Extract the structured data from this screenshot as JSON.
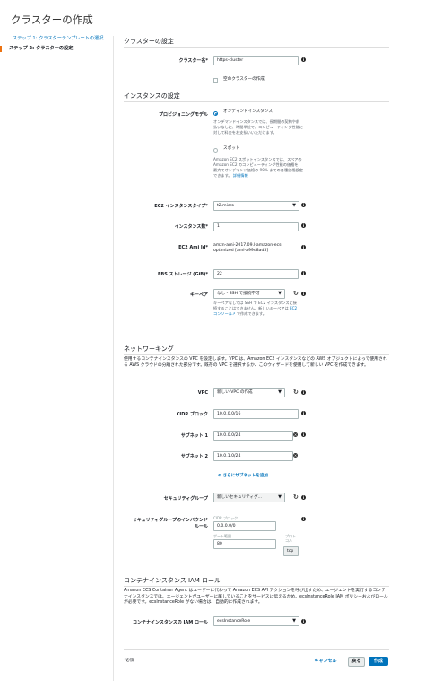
{
  "page": {
    "title": "クラスターの作成"
  },
  "steps": {
    "step1": "ステップ 1: クラスターテンプレートの選択",
    "step2": "ステップ 2: クラスターの設定"
  },
  "cluster": {
    "section_title": "クラスターの設定",
    "name_label": "クラスター名*",
    "name_value": "https-cluster",
    "empty_cluster_label": "空のクラスターの作成"
  },
  "instance": {
    "section_title": "インスタンスの設定",
    "provisioning_label": "プロビジョニングモデル",
    "ondemand_label": "オンデマンドインスタンス",
    "ondemand_desc": "オンデマンドインスタンスでは、長期間の契約や前払いなしに、時間単位で、コンピューティング性能に対して料金をお支払いいただけます。",
    "spot_label": "スポット",
    "spot_desc": "Amazon EC2 スポットインスタンスでは、スペアの Amazon EC2 のコンピューティング性能の価格を、最大でオンデマンド価格の 90% までの各種価格設定できます。",
    "spot_link": "詳細情報",
    "type_label": "EC2 インスタンスタイプ*",
    "type_value": "t2.micro",
    "count_label": "インスタンス数*",
    "count_value": "1",
    "ami_label": "EC2 Ami Id*",
    "ami_value": "amzn-ami-2017.09.l-amazon-ecs-optimized [ami-a99d8ad5]",
    "ebs_label": "EBS ストレージ (GiB)*",
    "ebs_value": "22",
    "keypair_label": "キーペア",
    "keypair_value": "なし - SSH で接続不可",
    "keypair_desc": "キーペアなしでは SSH で EC2 インスタンスに接続することはできません。新しいキーペアは",
    "keypair_link": "EC2 コンソール",
    "keypair_desc_tail": "で作成できます。"
  },
  "network": {
    "section_title": "ネットワーキング",
    "desc": "使用するコンテナインスタンスの VPC を設定します。VPC は、Amazon EC2 インスタンスなどの AWS オブジェクトによって使用される AWS クラウドの分離された部分です。既存の VPC を選択するか、このウィザードを使用して新しい VPC を作成できます。",
    "vpc_label": "VPC",
    "vpc_value": "新しい VPC の作成",
    "cidr_label": "CIDR ブロック",
    "cidr_value": "10.0.0.0/16",
    "subnet1_label": "サブネット 1",
    "subnet1_value": "10.0.0.0/24",
    "subnet2_label": "サブネット 2",
    "subnet2_value": "10.0.1.0/24",
    "add_subnet": "さらにサブネットを追加",
    "sg_label": "セキュリティグループ",
    "sg_value": "新しいセキュリティグ...",
    "inbound_label_1": "セキュリティグループのインバウンド",
    "inbound_label_2": "ルール",
    "cidr_field_label": "CIDR ブロック",
    "cidr_field_value": "0.0.0.0/0",
    "port_field_label": "ポート範囲",
    "port_field_value": "80",
    "protocol_label_1": "プロト",
    "protocol_label_2": "コル",
    "protocol_value": "tcp"
  },
  "iam": {
    "section_title": "コンテナインスタンス IAM ロール",
    "desc": "Amazon ECS Container Agent はユーザーに代わって Amazon ECS API アクションを呼び出すため、エージェントを実行するコンテナインスタンスでは、エージェントがユーザーに属していることをサービスに伝えるため、ecsInstanceRole IAM ポリシーおよびロールが必要です。ecsInstanceRole がない場合は、自動的に作成されます。",
    "role_label": "コンテナインスタンスの IAM ロール",
    "role_value": "ecsInstanceRole"
  },
  "footer": {
    "required": "*必須",
    "cancel": "キャンセル",
    "back": "戻る",
    "create": "作成"
  }
}
